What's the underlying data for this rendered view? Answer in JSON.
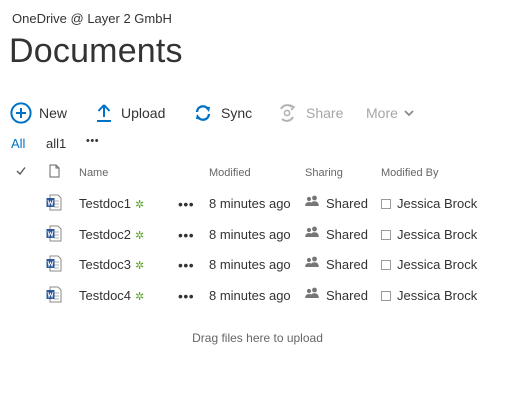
{
  "site_title": "OneDrive @ Layer 2 GmbH",
  "page_title": "Documents",
  "toolbar": {
    "new_label": "New",
    "upload_label": "Upload",
    "sync_label": "Sync",
    "share_label": "Share",
    "more_label": "More"
  },
  "views": {
    "all_label": "All",
    "all1_label": "all1",
    "more_label": "•••"
  },
  "columns": {
    "name": "Name",
    "modified": "Modified",
    "sharing": "Sharing",
    "modified_by": "Modified By"
  },
  "rows": [
    {
      "name": "Testdoc1",
      "new_marker": "✲",
      "menu": "•••",
      "modified": "8 minutes ago",
      "sharing": "Shared",
      "modified_by": "Jessica Brock"
    },
    {
      "name": "Testdoc2",
      "new_marker": "✲",
      "menu": "•••",
      "modified": "8 minutes ago",
      "sharing": "Shared",
      "modified_by": "Jessica Brock"
    },
    {
      "name": "Testdoc3",
      "new_marker": "✲",
      "menu": "•••",
      "modified": "8 minutes ago",
      "sharing": "Shared",
      "modified_by": "Jessica Brock"
    },
    {
      "name": "Testdoc4",
      "new_marker": "✲",
      "menu": "•••",
      "modified": "8 minutes ago",
      "sharing": "Shared",
      "modified_by": "Jessica Brock"
    }
  ],
  "drag_hint": "Drag files here to upload",
  "colors": {
    "accent": "#0072c6",
    "new_marker": "#5ea52f",
    "disabled": "#a6a6a6"
  },
  "icons": [
    "plus-circle-icon",
    "upload-arrow-icon",
    "sync-icon",
    "share-icon",
    "chevron-down-icon",
    "checkmark-icon",
    "file-icon",
    "word-doc-icon",
    "people-icon"
  ]
}
